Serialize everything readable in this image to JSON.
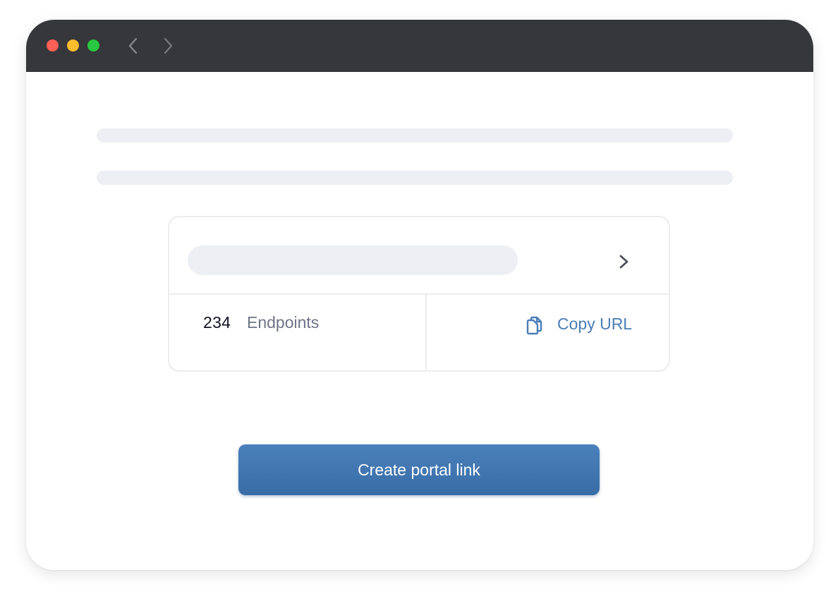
{
  "window": {
    "controls": [
      "close",
      "minimize",
      "maximize"
    ],
    "nav": {
      "back_icon": "chevron-left-icon",
      "forward_icon": "chevron-right-icon"
    }
  },
  "card": {
    "open_icon": "chevron-right-icon",
    "endpoint_count": "234",
    "endpoint_label": "Endpoints",
    "copy_icon": "copy-icon",
    "copy_label": "Copy URL"
  },
  "primary_action": {
    "label": "Create portal link"
  },
  "colors": {
    "titlebar": "#36373b",
    "accent": "#4a7db5",
    "button": "#3f75b0",
    "skeleton": "#eeeff4",
    "traffic_red": "#fe5f57",
    "traffic_yellow": "#febc2e",
    "traffic_green": "#28c840"
  }
}
